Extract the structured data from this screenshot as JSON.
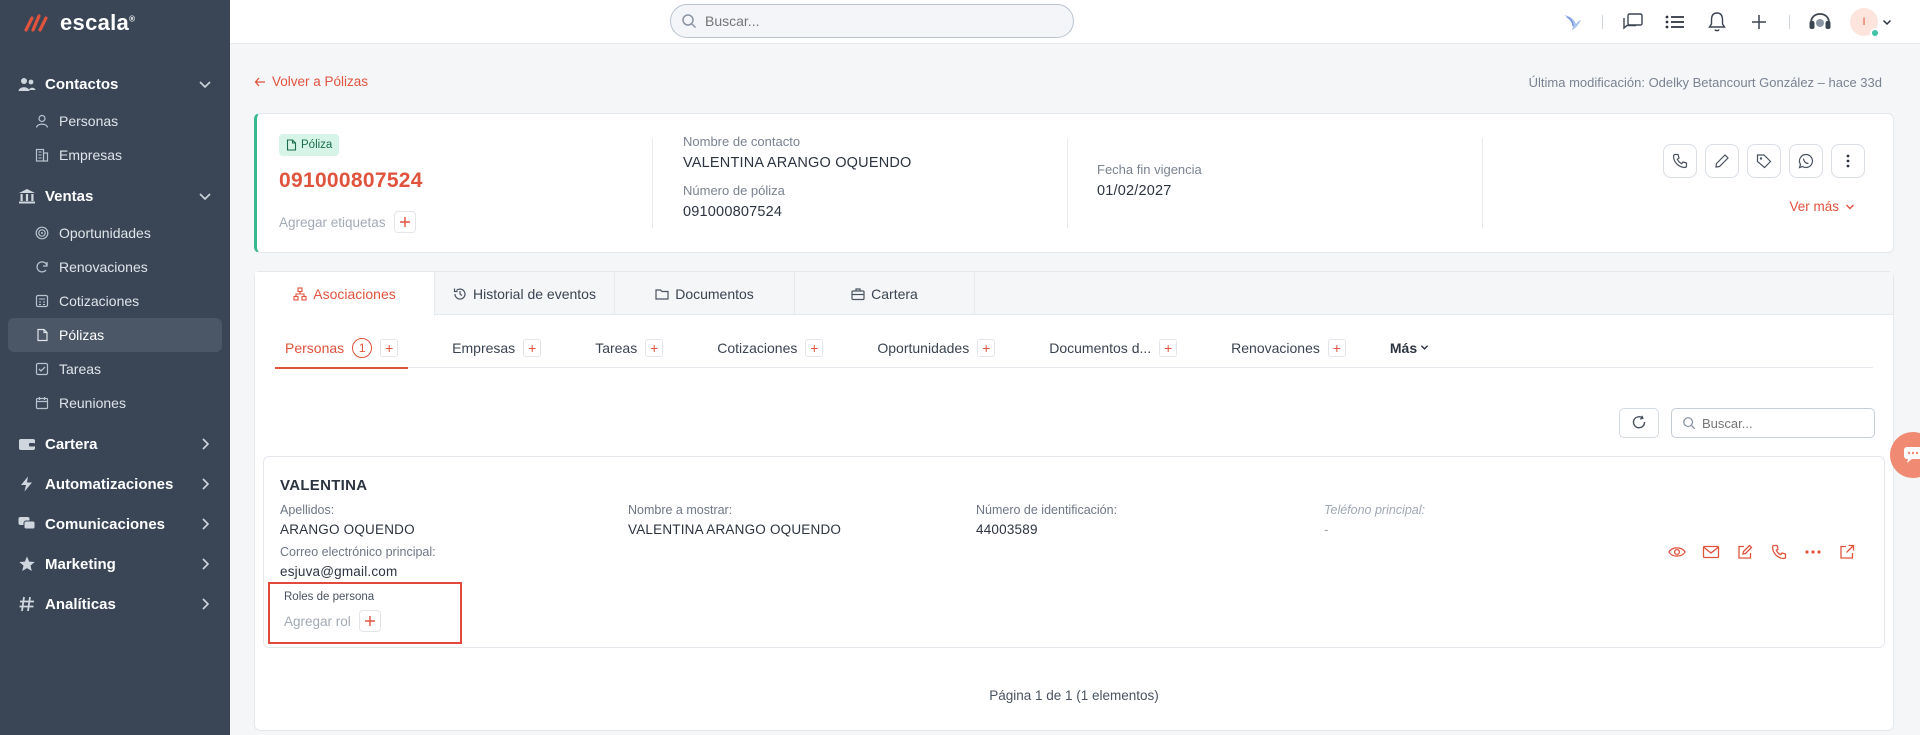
{
  "brand": {
    "name": "escala",
    "mark": "®",
    "accent": "#e0533d",
    "sidebar_bg": "#3a4656"
  },
  "topbar": {
    "search_placeholder": "Buscar...",
    "avatar_initial": "I"
  },
  "sidebar": {
    "sections": [
      {
        "label": "Contactos",
        "icon": "users-icon",
        "expanded": true,
        "items": [
          {
            "label": "Personas",
            "icon": "person-icon"
          },
          {
            "label": "Empresas",
            "icon": "building-icon"
          }
        ]
      },
      {
        "label": "Ventas",
        "icon": "bank-icon",
        "expanded": true,
        "items": [
          {
            "label": "Oportunidades",
            "icon": "target-icon"
          },
          {
            "label": "Renovaciones",
            "icon": "refresh-icon"
          },
          {
            "label": "Cotizaciones",
            "icon": "calculator-icon"
          },
          {
            "label": "Pólizas",
            "icon": "document-icon",
            "active": true
          },
          {
            "label": "Tareas",
            "icon": "checklist-icon"
          },
          {
            "label": "Reuniones",
            "icon": "calendar-icon"
          }
        ]
      },
      {
        "label": "Cartera",
        "icon": "wallet-icon",
        "expanded": false
      },
      {
        "label": "Automatizaciones",
        "icon": "bolt-icon",
        "expanded": false
      },
      {
        "label": "Comunicaciones",
        "icon": "chat-icon",
        "expanded": false
      },
      {
        "label": "Marketing",
        "icon": "star-icon",
        "expanded": false
      },
      {
        "label": "Analíticas",
        "icon": "hash-icon",
        "expanded": false
      }
    ]
  },
  "page": {
    "back_label": "Volver a Pólizas",
    "last_modified": "Última modificación: Odelky Betancourt González – hace 33d"
  },
  "header": {
    "badge": "Póliza",
    "policy_number": "091000807524",
    "add_tags_label": "Agregar etiquetas",
    "contact_label": "Nombre de contacto",
    "contact_value": "VALENTINA ARANGO OQUENDO",
    "policy_number_label": "Número de póliza",
    "policy_number_value": "091000807524",
    "end_date_label": "Fecha fin vigencia",
    "end_date_value": "01/02/2027",
    "see_more": "Ver más"
  },
  "main_tabs": [
    {
      "label": "Asociaciones",
      "icon": "sitemap-icon",
      "active": true
    },
    {
      "label": "Historial de eventos",
      "icon": "history-icon"
    },
    {
      "label": "Documentos",
      "icon": "folder-icon"
    },
    {
      "label": "Cartera",
      "icon": "briefcase-icon"
    }
  ],
  "sub_tabs": {
    "items": [
      {
        "label": "Personas",
        "count": "1",
        "active": true
      },
      {
        "label": "Empresas"
      },
      {
        "label": "Tareas"
      },
      {
        "label": "Cotizaciones"
      },
      {
        "label": "Oportunidades"
      },
      {
        "label": "Documentos d..."
      },
      {
        "label": "Renovaciones"
      }
    ],
    "more": "Más"
  },
  "list": {
    "search_placeholder": "Buscar..."
  },
  "person": {
    "name": "VALENTINA",
    "surname_label": "Apellidos:",
    "surname_value": "ARANGO OQUENDO",
    "display_label": "Nombre a mostrar:",
    "display_value": "VALENTINA ARANGO OQUENDO",
    "id_label": "Número de identificación:",
    "id_value": "44003589",
    "phone_label": "Teléfono principal:",
    "phone_value": "-",
    "email_label": "Correo electrónico principal:",
    "email_value": "esjuva@gmail.com",
    "roles_label": "Roles de persona",
    "add_role": "Agregar rol"
  },
  "pager": {
    "text": "Página 1 de 1 (1 elementos)"
  }
}
